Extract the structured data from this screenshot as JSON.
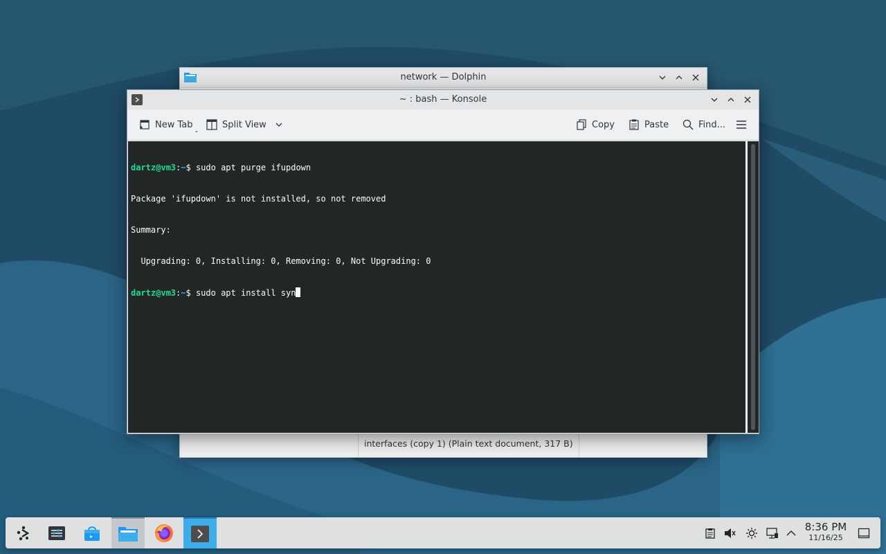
{
  "dolphin": {
    "title": "network — Dolphin",
    "status": "interfaces (copy 1) (Plain text document, 317 B)"
  },
  "konsole": {
    "title": "~ : bash — Konsole",
    "toolbar": {
      "new_tab": "New Tab",
      "split_view": "Split View",
      "copy": "Copy",
      "paste": "Paste",
      "find": "Find..."
    },
    "terminal": {
      "user_host": "dartz@vm3",
      "path": "~",
      "lines": [
        {
          "kind": "prompt",
          "command": "sudo apt purge ifupdown"
        },
        {
          "kind": "output",
          "text": "Package 'ifupdown' is not installed, so not removed"
        },
        {
          "kind": "output",
          "text": "Summary:"
        },
        {
          "kind": "output",
          "text": "  Upgrading: 0, Installing: 0, Removing: 0, Not Upgrading: 0"
        },
        {
          "kind": "prompt",
          "command": "sudo apt install syn"
        }
      ]
    }
  },
  "taskbar": {
    "time": "8:36 PM",
    "date": "11/16/25",
    "apps": [
      "application-launcher-icon",
      "system-settings-icon",
      "discover-icon",
      "dolphin-icon",
      "firefox-icon",
      "konsole-icon"
    ]
  },
  "colors": {
    "terminal_bg": "#232627",
    "prompt_user": "#1cdc9a",
    "prompt_path": "#3daee9",
    "accent": "#3daee9"
  }
}
